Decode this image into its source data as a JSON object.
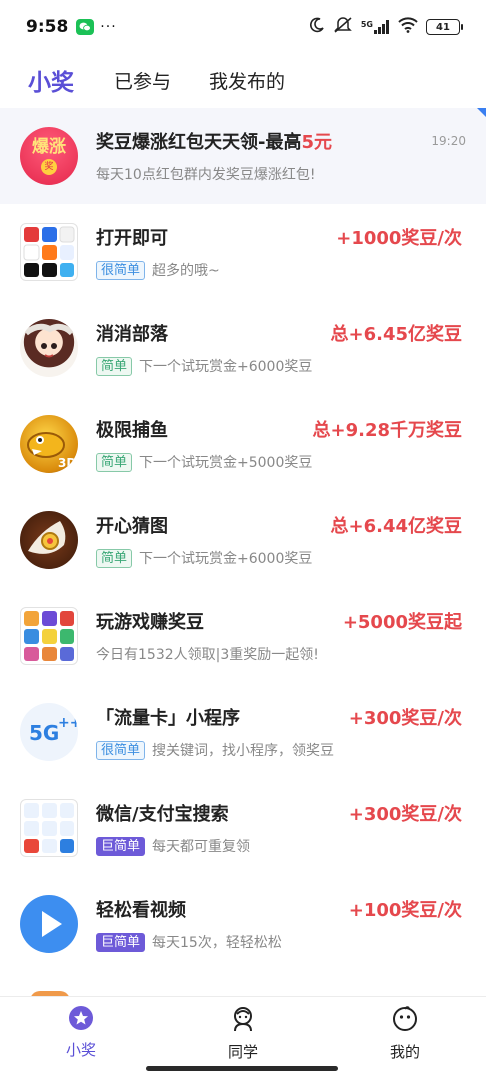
{
  "status_bar": {
    "time": "9:58",
    "dots": "···",
    "network": "5G",
    "battery": "41",
    "icons": [
      "wechat-icon",
      "moon-icon",
      "mute-icon",
      "signal-icon",
      "wifi-icon",
      "battery-icon"
    ]
  },
  "tabs": [
    {
      "label": "小奖",
      "active": true
    },
    {
      "label": "已参与",
      "active": false
    },
    {
      "label": "我发布的",
      "active": false
    }
  ],
  "banner": {
    "title_main": "奖豆爆涨红包天天领-最高",
    "title_highlight": "5元",
    "subtitle": "每天10点红包群内发奖豆爆涨红包!",
    "time": "19:20",
    "avatar_text": "爆涨",
    "avatar_badge": "奖"
  },
  "items": [
    {
      "title": "打开即可",
      "reward": "+1000奖豆/次",
      "tag": "很简单",
      "tag_style": "blue",
      "desc": "超多的哦~",
      "icon": "app-grid-icon"
    },
    {
      "title": "消消部落",
      "reward": "总+6.45亿奖豆",
      "tag": "简单",
      "tag_style": "green",
      "desc": "下一个试玩赏金+6000奖豆",
      "icon": "game-girl-icon"
    },
    {
      "title": "极限捕鱼",
      "reward": "总+9.28千万奖豆",
      "tag": "简单",
      "tag_style": "green",
      "desc": "下一个试玩赏金+5000奖豆",
      "icon": "golden-fish-icon"
    },
    {
      "title": "开心猜图",
      "reward": "总+6.44亿奖豆",
      "tag": "简单",
      "tag_style": "green",
      "desc": "下一个试玩赏金+6000奖豆",
      "icon": "guess-picture-icon"
    },
    {
      "title": "玩游戏赚奖豆",
      "reward": "+5000奖豆起",
      "tag": "",
      "tag_style": "",
      "desc": "今日有1532人领取|3重奖励一起领!",
      "icon": "games-grid-icon"
    },
    {
      "title": "「流量卡」小程序",
      "reward": "+300奖豆/次",
      "tag": "很简单",
      "tag_style": "blue",
      "desc": "搜关键词，找小程序，领奖豆",
      "icon": "5g-plus-icon"
    },
    {
      "title": "微信/支付宝搜索",
      "reward": "+300奖豆/次",
      "tag": "巨简单",
      "tag_style": "purple",
      "desc": "每天都可重复领",
      "icon": "5g-grid-icon"
    },
    {
      "title": "轻松看视频",
      "reward": "+100奖豆/次",
      "tag": "巨简单",
      "tag_style": "purple",
      "desc": "每天15次，轻轻松松",
      "icon": "play-icon"
    }
  ],
  "bottom_nav": [
    {
      "label": "小奖",
      "icon": "star-icon",
      "active": true
    },
    {
      "label": "同学",
      "icon": "classmate-icon",
      "active": false
    },
    {
      "label": "我的",
      "icon": "profile-face-icon",
      "active": false
    }
  ],
  "colors": {
    "accent": "#5a4fd6",
    "reward": "#e5484d",
    "tag_blue": "#3d8fe0",
    "tag_green": "#3aa776",
    "tag_purple": "#6d5ad8"
  }
}
